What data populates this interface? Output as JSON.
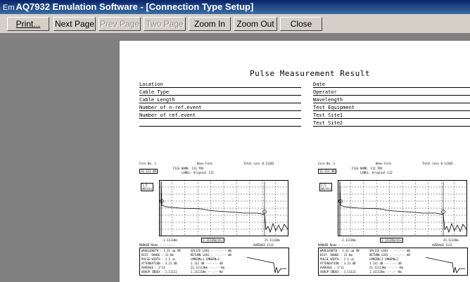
{
  "window": {
    "icon_text": "Em",
    "title": "AQ7932 Emulation Software - [Connection Type Setup]"
  },
  "toolbar": {
    "buttons": [
      {
        "label": "Print...",
        "disabled": false
      },
      {
        "label": "Next Page",
        "disabled": false
      },
      {
        "label": "Prev Page",
        "disabled": true
      },
      {
        "label": "Two Page",
        "disabled": true
      },
      {
        "label": "Zoom In",
        "disabled": false
      },
      {
        "label": "Zoom Out",
        "disabled": false
      },
      {
        "label": "Close",
        "disabled": false
      }
    ]
  },
  "document": {
    "title": "Pulse Measurement Result",
    "left_fields": [
      "Location",
      "Cable Type",
      "Cable Length",
      "Number of n-ref.event",
      "Number of ref.event"
    ],
    "right_fields": [
      "Date",
      "Operator",
      "Wavelength",
      "Test Equipment",
      "Test Site1",
      "Test Site2"
    ]
  },
  "traces": [
    {
      "core_no": "Core No. 1",
      "wave_form": "Wave Form",
      "total_loss": "Total Loss 0.1110Z",
      "file_name": "FILE NAME: 111.TRX",
      "label": "LABEL: Original 111",
      "start": "11.111 dB",
      "yscale": "1.5",
      "yscale_unit": "dB/div",
      "xl": "-1.1111Km",
      "xdiv": "1.1111Km/div",
      "xend": "25.1111Km",
      "marker": "MARKER Mode : -------",
      "average": "AVERAGE 1111",
      "params": [
        "WAVELENGTH : 1.31 um SM",
        "DIST. RANGE : 11 Km",
        "PULSE WIDTH : 1.1 us",
        "ATTENUATION : 3.21 dB",
        "AVERAGE : 2^11",
        "GROUP INDEX : 1.11111"
      ],
      "params2": [
        "SPLICE LOSS : ---.--- dB",
        "RETURN LOSS : ---.--- dB",
        "LMKERN=1 LMKERN=2",
        "1.111 dB ---.--- dB",
        "21.11111Km ---.---Km",
        "1.11111Km ---.---Km"
      ]
    },
    {
      "core_no": "Core No. 2",
      "wave_form": "Wave Form",
      "total_loss": "Total Loss 0.1110Z",
      "file_name": "FILE NAME: 112.TRX",
      "label": "LABEL: Original 112",
      "start": "11.111 dB",
      "yscale": "1.5",
      "yscale_unit": "dB/div",
      "xl": "-1.1111Km",
      "xdiv": "1.1111Km/div",
      "xend": "25.1111Km",
      "marker": "MARKER Mode : -------",
      "average": "AVERAGE 1111",
      "params": [
        "WAVELENGTH : 1.31 um SM",
        "DIST. RANGE : 11 Km",
        "PULSE WIDTH : 1.1 us",
        "ATTENUATION : 3.21 dB",
        "AVERAGE : 2^11",
        "GROUP INDEX : 1.11111"
      ],
      "params2": [
        "SPLICE LOSS : ---.--- dB",
        "RETURN LOSS : ---.--- dB",
        "LMKERN=1 LMKERN=2",
        "1.111 dB ---.--- dB",
        "21.11111Km ---.---Km",
        "1.11111Km ---.---Km"
      ]
    }
  ]
}
